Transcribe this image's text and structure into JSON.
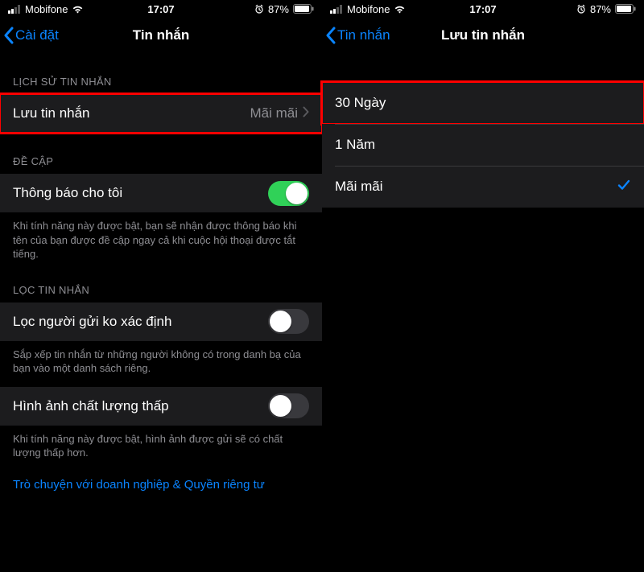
{
  "statusbar": {
    "carrier": "Mobifone",
    "time": "17:07",
    "battery_pct": "87%"
  },
  "left": {
    "back_label": "Cài đặt",
    "title": "Tin nhắn",
    "section_history": "LỊCH SỬ TIN NHẮN",
    "keep_messages": {
      "label": "Lưu tin nhắn",
      "value": "Mãi mãi"
    },
    "section_mention": "ĐỀ CẬP",
    "notify_me": {
      "label": "Thông báo cho tôi",
      "on": true
    },
    "notify_footer": "Khi tính năng này được bật, bạn sẽ nhận được thông báo khi tên của bạn được đề cập ngay cả khi cuộc hội thoại được tắt tiếng.",
    "section_filter": "LỌC TIN NHẮN",
    "filter_unknown": {
      "label": "Lọc người gửi ko xác định",
      "on": false
    },
    "filter_footer": "Sắp xếp tin nhắn từ những người không có trong danh bạ của bạn vào một danh sách riêng.",
    "low_quality": {
      "label": "Hình ảnh chất lượng thấp",
      "on": false
    },
    "low_quality_footer": "Khi tính năng này được bật, hình ảnh được gửi sẽ có chất lượng thấp hơn.",
    "business_link": "Trò chuyện với doanh nghiệp & Quyền riêng tư"
  },
  "right": {
    "back_label": "Tin nhắn",
    "title": "Lưu tin nhắn",
    "options": {
      "o0": "30 Ngày",
      "o1": "1 Năm",
      "o2": "Mãi mãi"
    },
    "selected_index": 2
  }
}
